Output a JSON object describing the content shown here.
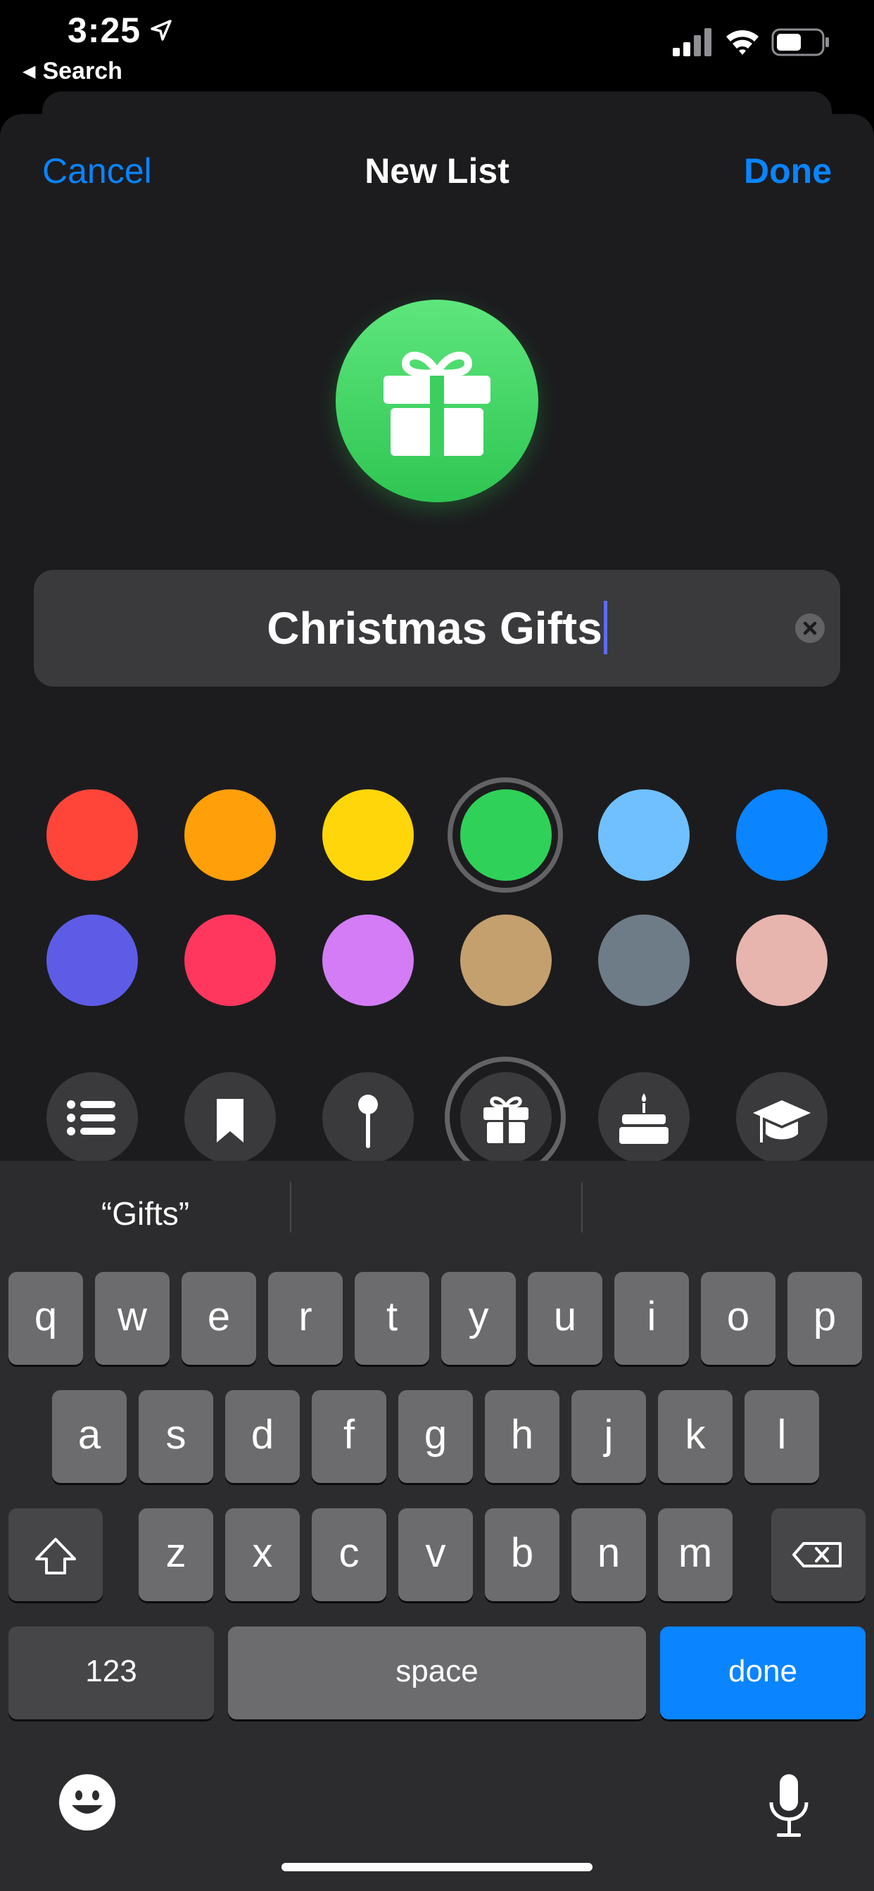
{
  "status_bar": {
    "time": "3:25",
    "back_label": "Search"
  },
  "nav": {
    "cancel": "Cancel",
    "title": "New List",
    "done": "Done"
  },
  "list": {
    "name": "Christmas Gifts",
    "selected_color": "#30d158",
    "selected_icon": "gift-icon"
  },
  "colors": [
    "#ff453a",
    "#ff9f0a",
    "#ffd60a",
    "#30d158",
    "#70c0ff",
    "#0a84ff",
    "#5e5ce6",
    "#ff375f",
    "#d37cf6",
    "#c4a06f",
    "#6e7c88",
    "#e8b4ae"
  ],
  "symbols": [
    "list-icon",
    "bookmark-icon",
    "pin-icon",
    "gift-icon",
    "cake-icon",
    "graduation-cap-icon"
  ],
  "keyboard": {
    "suggestions": [
      "“Gifts”",
      "",
      ""
    ],
    "row1": [
      "q",
      "w",
      "e",
      "r",
      "t",
      "y",
      "u",
      "i",
      "o",
      "p"
    ],
    "row2": [
      "a",
      "s",
      "d",
      "f",
      "g",
      "h",
      "j",
      "k",
      "l"
    ],
    "row3": [
      "z",
      "x",
      "c",
      "v",
      "b",
      "n",
      "m"
    ],
    "numbers_key": "123",
    "space_key": "space",
    "return_key": "done"
  }
}
